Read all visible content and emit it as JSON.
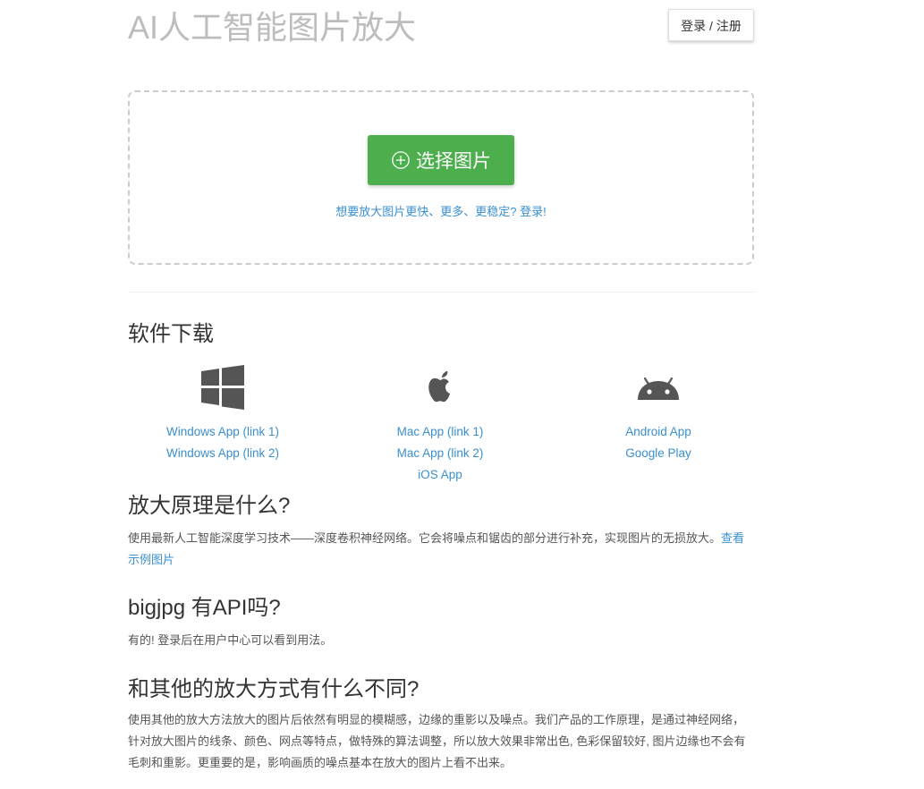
{
  "header": {
    "title": "AI人工智能图片放大",
    "login_label": "登录 / 注册"
  },
  "upload": {
    "button_label": "选择图片",
    "button_icon": "plus-circle-icon",
    "promo_link": "想要放大图片更快、更多、更稳定? 登录!"
  },
  "downloads": {
    "heading": "软件下载",
    "windows": {
      "icon": "windows-icon",
      "links": [
        "Windows App (link 1)",
        "Windows App (link 2)"
      ]
    },
    "mac": {
      "icon": "apple-icon",
      "links": [
        "Mac App (link 1)",
        "Mac App (link 2)",
        "iOS App"
      ]
    },
    "android": {
      "icon": "android-icon",
      "links": [
        "Android App",
        "Google Play"
      ]
    }
  },
  "faq": [
    {
      "question": "放大原理是什么?",
      "answer": "使用最新人工智能深度学习技术——深度卷积神经网络。它会将噪点和锯齿的部分进行补充，实现图片的无损放大。",
      "link": "查看示例图片"
    },
    {
      "question": "bigjpg 有API吗?",
      "answer": "有的! 登录后在用户中心可以看到用法。"
    },
    {
      "question": "和其他的放大方式有什么不同?",
      "answer": "使用其他的放大方法放大的图片后依然有明显的模糊感，边缘的重影以及噪点。我们产品的工作原理，是通过神经网络，针对放大图片的线条、颜色、网点等特点，做特殊的算法调整，所以放大效果非常出色, 色彩保留较好, 图片边缘也不会有毛刺和重影。更重要的是，影响画质的噪点基本在放大的图片上看不出来。"
    }
  ],
  "colors": {
    "accent_green": "#4cae4c",
    "link_blue": "#3a8fd0",
    "title_gray": "#bdbdbd"
  }
}
